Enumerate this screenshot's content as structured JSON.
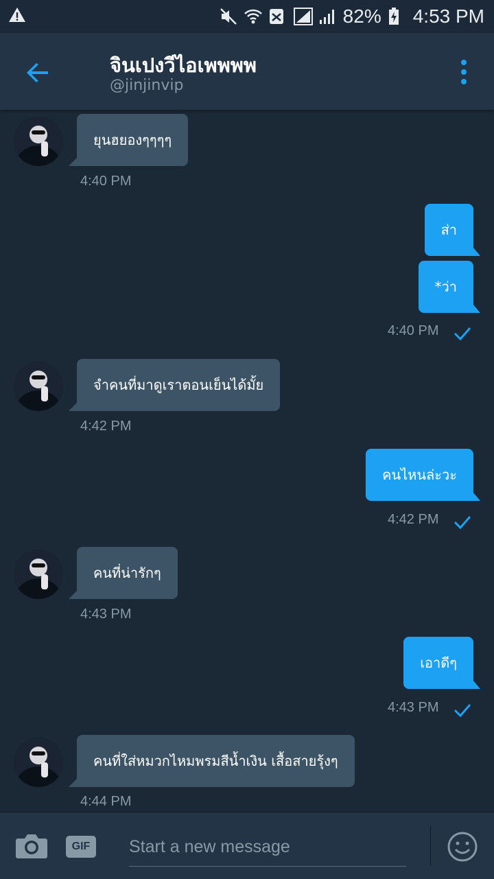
{
  "status_bar": {
    "battery": "82%",
    "time": "4:53 PM",
    "icons": [
      "warning-icon",
      "mute-icon",
      "wifi-icon",
      "sim-icon",
      "signal-icon",
      "battery-charging-icon"
    ]
  },
  "header": {
    "title": "จินเปงวีไอเพพพพ",
    "handle": "@jinjinvip"
  },
  "messages": [
    {
      "dir": "in",
      "text": "ยุนฮยองๆๆๆๆ"
    },
    {
      "dir": "in",
      "time": "4:40 PM"
    },
    {
      "dir": "out",
      "text": "ส่า"
    },
    {
      "dir": "out",
      "text": "*ว่า",
      "time": "4:40 PM",
      "read": true
    },
    {
      "dir": "in",
      "text": "จำคนที่มาดูเราตอนเย็นได้มั้ย",
      "time": "4:42 PM"
    },
    {
      "dir": "out",
      "text": "คนไหนล่ะวะ",
      "time": "4:42 PM",
      "read": true
    },
    {
      "dir": "in",
      "text": "คนที่น่ารักๆ",
      "time": "4:43 PM"
    },
    {
      "dir": "out",
      "text": "เอาดีๆ",
      "time": "4:43 PM",
      "read": true
    },
    {
      "dir": "in",
      "text": "คนที่ใส่หมวกไหมพรมสีน้ำเงิน เสื้อสายรุ้งๆ",
      "time": "4:44 PM"
    }
  ],
  "composer": {
    "gif_label": "GIF",
    "placeholder": "Start a new message"
  },
  "colors": {
    "background": "#1b2836",
    "header": "#243447",
    "accent": "#1da1f2",
    "incoming_bubble": "#3d5466",
    "muted_text": "#8899a6"
  }
}
